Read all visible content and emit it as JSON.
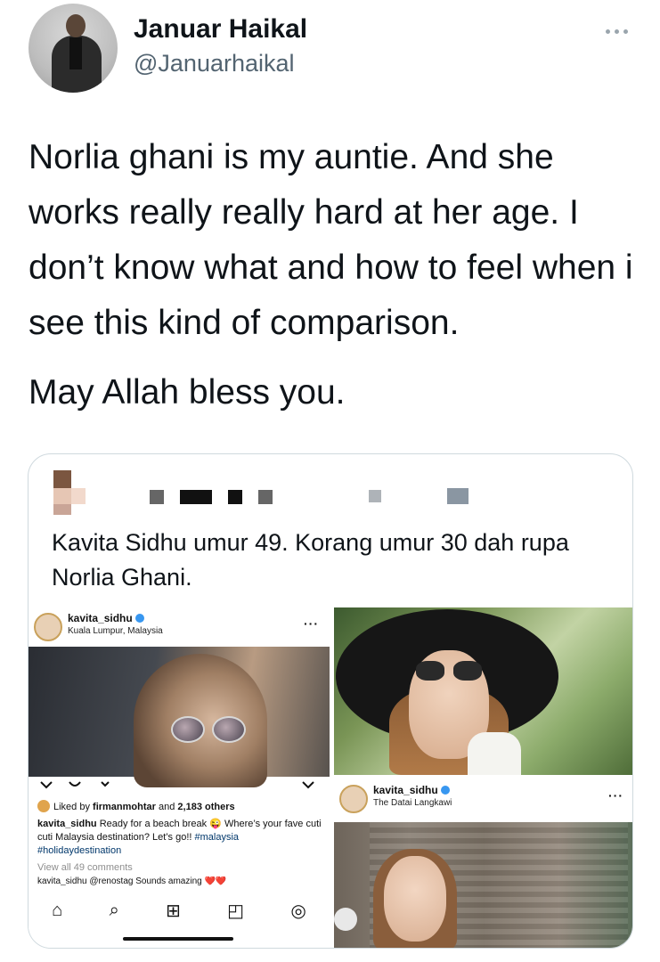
{
  "tweet": {
    "author_name": "Januar Haikal",
    "author_handle": "@Januarhaikal",
    "paragraph_1": "Norlia ghani is my auntie. And she works really really hard at her age. I don’t know what and how to feel when i see this kind of comparison.",
    "paragraph_2": "May Allah bless you."
  },
  "quoted_tweet": {
    "text": "Kavita Sidhu umur 49. Korang umur 30 dah rupa Norlia Ghani."
  },
  "instagram_post_1": {
    "username": "kavita_sidhu",
    "location": "Kuala Lumpur, Malaysia",
    "likes_prefix": "Liked by ",
    "liked_by_user": "firmanmohtar",
    "likes_mid": " and ",
    "likes_count": "2,183 others",
    "caption_user": "kavita_sidhu",
    "caption_text": " Ready for a beach break 😜 Where’s your fave cuti cuti Malaysia destination? Let’s go!! ",
    "caption_tag_1": "#malaysia",
    "caption_tag_2": "#holidaydestination",
    "view_all": "View all 49 comments",
    "comment_preview": "kavita_sidhu @renostag Sounds amazing ❤️❤️"
  },
  "instagram_post_2": {
    "username": "kavita_sidhu",
    "location": "The Datai Langkawi"
  },
  "icons": {
    "more": "more-horizontal-icon",
    "verified": "verified-badge-icon",
    "home": "⌂",
    "search": "⌕",
    "add": "⊞",
    "shop": "◰",
    "profile": "◎"
  },
  "colors": {
    "text_primary": "#0f1419",
    "text_secondary": "#536471",
    "border": "#cfd9de",
    "ig_verified": "#3897f0",
    "ig_tag": "#00376b"
  }
}
